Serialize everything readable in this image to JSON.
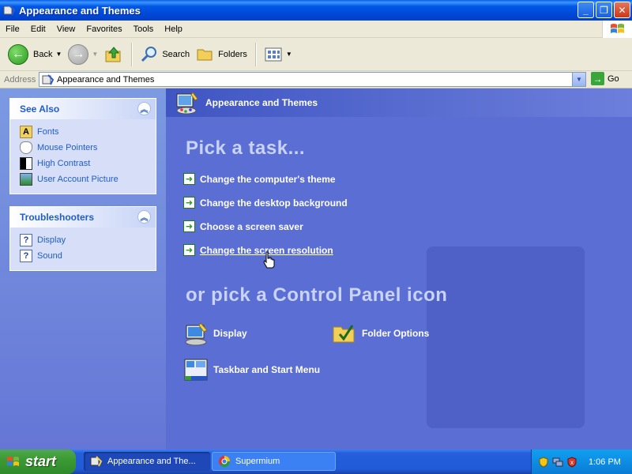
{
  "window": {
    "title": "Appearance and Themes"
  },
  "menu": [
    "File",
    "Edit",
    "View",
    "Favorites",
    "Tools",
    "Help"
  ],
  "toolbar": {
    "back": "Back",
    "search": "Search",
    "folders": "Folders"
  },
  "address": {
    "label": "Address",
    "value": "Appearance and Themes",
    "go": "Go"
  },
  "see_also": {
    "title": "See Also",
    "items": [
      "Fonts",
      "Mouse Pointers",
      "High Contrast",
      "User Account Picture"
    ]
  },
  "troubleshooters": {
    "title": "Troubleshooters",
    "items": [
      "Display",
      "Sound"
    ]
  },
  "main": {
    "category_title": "Appearance and Themes",
    "pick_task": "Pick a task...",
    "tasks": [
      "Change the computer's theme",
      "Change the desktop background",
      "Choose a screen saver",
      "Change the screen resolution"
    ],
    "pick_icon": "or pick a Control Panel icon",
    "icons": [
      "Display",
      "Folder Options",
      "Taskbar and Start Menu"
    ]
  },
  "taskbar": {
    "start": "start",
    "buttons": [
      "Appearance and The...",
      "Supermium"
    ],
    "clock": "1:06 PM"
  }
}
